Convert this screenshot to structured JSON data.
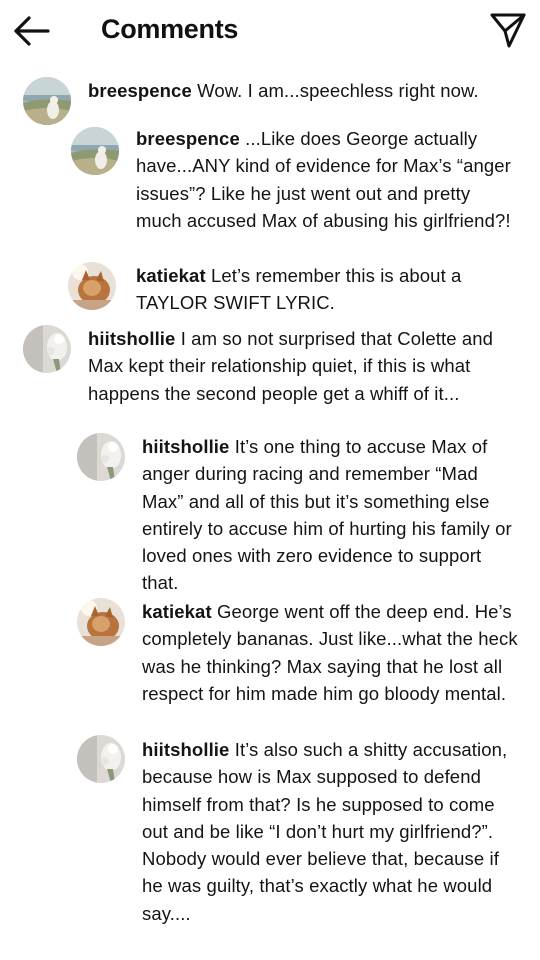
{
  "header": {
    "title": "Comments",
    "back_icon": "arrow-left-icon",
    "send_icon": "paper-plane-icon"
  },
  "comments": [
    {
      "username": "breespence",
      "text": "Wow. I am...speechless right now.",
      "avatar": "beach-dog-photo"
    },
    {
      "username": "breespence",
      "text": "...Like does George actually have...ANY kind of evidence for Max’s “anger issues”? Like he just went out and pretty much accused Max of abusing his girlfriend?!",
      "avatar": "beach-dog-photo"
    },
    {
      "username": "katiekat",
      "text": "Let’s remember this is about a TAYLOR SWIFT LYRIC.",
      "avatar": "cat-photo"
    },
    {
      "username": "hiitshollie",
      "text": "I am so not surprised that Colette and Max kept their relationship quiet, if this is what happens the second people get a whiff of it...",
      "avatar": "flowers-photo"
    },
    {
      "username": "hiitshollie",
      "text": "It’s one thing to accuse Max of anger during racing and remember “Mad Max” and all of this but it’s something else entirely to accuse him of hurting his family or loved ones with zero evidence to support that.",
      "avatar": "flowers-photo"
    },
    {
      "username": "katiekat",
      "text": "George went off the deep end. He’s completely bananas. Just like...what the heck was he thinking? Max saying that he lost all respect for him made him go bloody mental.",
      "avatar": "cat-photo"
    },
    {
      "username": "hiitshollie",
      "text": "It’s also such a shitty accusation, because how is Max supposed to defend himself from that? Is he supposed to come out and be like “I don’t hurt my girlfriend?”. Nobody would ever believe that, because if he was guilty, that’s exactly what he would say....",
      "avatar": "flowers-photo"
    }
  ]
}
